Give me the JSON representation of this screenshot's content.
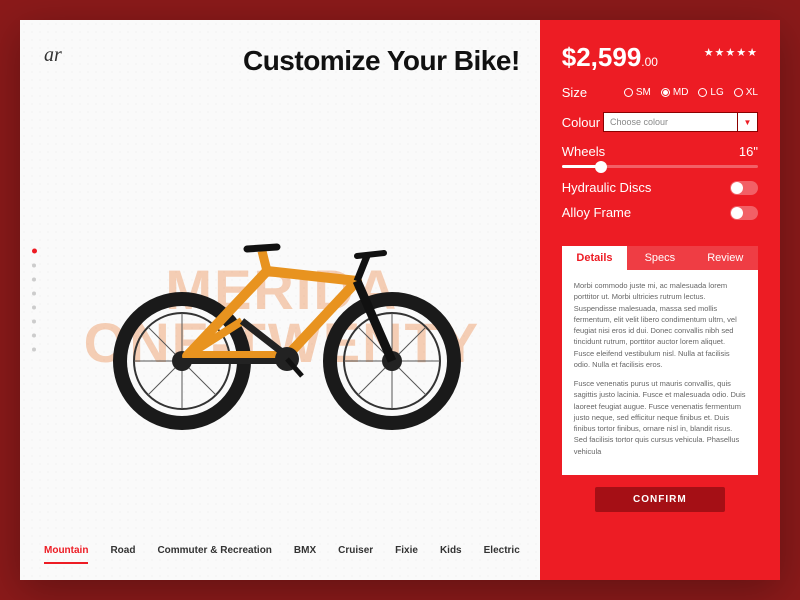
{
  "logo": "ar",
  "heading": "Customize Your Bike!",
  "watermark": "MERIDA\nONE-TWENTY",
  "categories": [
    "Mountain",
    "Road",
    "Commuter & Recreation",
    "BMX",
    "Cruiser",
    "Fixie",
    "Kids",
    "Electric"
  ],
  "active_category_index": 0,
  "dots_count": 8,
  "active_dot_index": 0,
  "price_main": "$2,599",
  "price_cents": ".00",
  "stars": "★★★★★",
  "size": {
    "label": "Size",
    "options": [
      "SM",
      "MD",
      "LG",
      "XL"
    ],
    "selected": "MD"
  },
  "colour": {
    "label": "Colour",
    "placeholder": "Choose colour"
  },
  "wheels": {
    "label": "Wheels",
    "value": "16\""
  },
  "toggles": [
    {
      "label": "Hydraulic Discs",
      "on": false
    },
    {
      "label": "Alloy Frame",
      "on": false
    }
  ],
  "tabs": [
    "Details",
    "Specs",
    "Review"
  ],
  "active_tab_index": 0,
  "details_p1": "Morbi commodo juste mi, ac malesuada lorem porttitor ut. Morbi ultricies rutrum lectus. Suspendisse malesuada, massa sed mollis fermentum, elit velit libero condimentum ultrn, vel feugiat nisi eros id dui. Donec convallis nibh sed tincidunt rutrum, porttitor auctor lorem aliquet. Fusce eleifend vestibulum nisl. Nulla at facilisis odio. Nulla et facilisis eros.",
  "details_p2": "Fusce venenatis purus ut mauris convallis, quis sagittis justo lacinia. Fusce et malesuada odio. Duis laoreet feugiat augue. Fusce venenatis fermentum justo neque, sed efficitur neque finibus et. Duis finibus tortor finibus, ornare nisl in, blandit risus. Sed facilisis tortor quis cursus vehicula. Phasellus vehicula",
  "confirm": "CONFIRM"
}
